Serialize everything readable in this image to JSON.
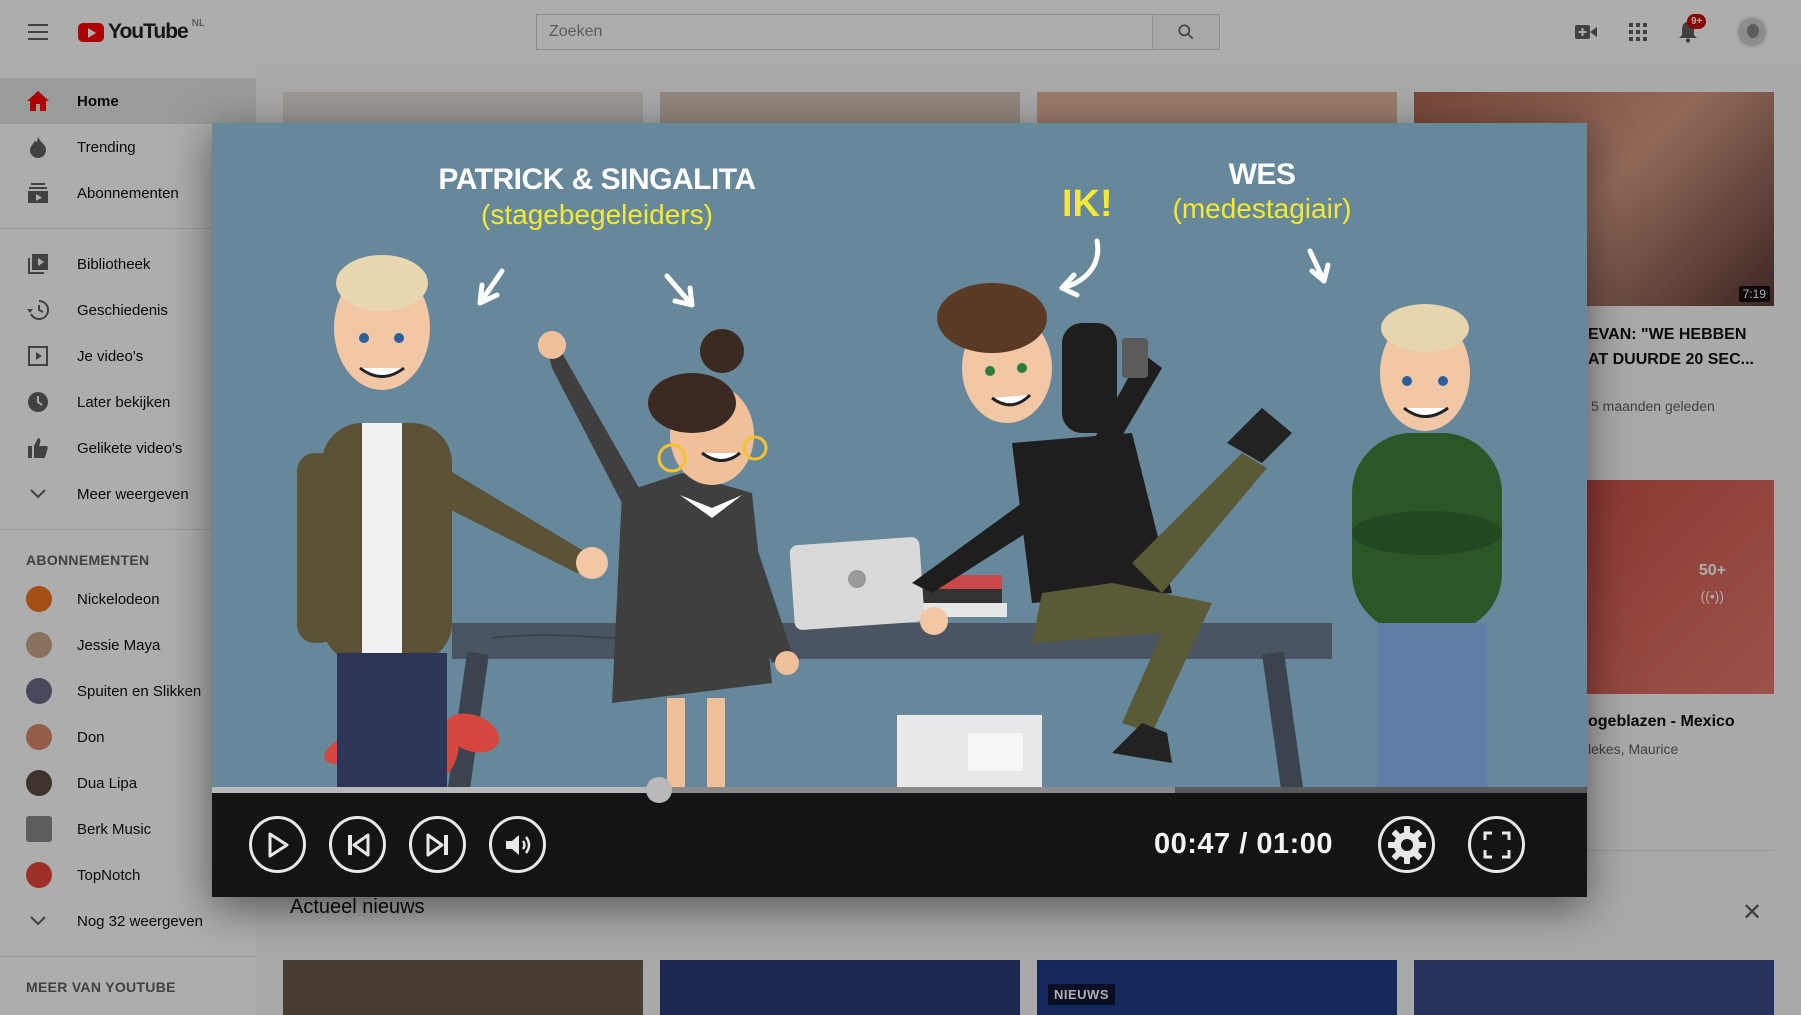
{
  "app": {
    "name": "YouTube",
    "region": "NL"
  },
  "header": {
    "search_placeholder": "Zoeken",
    "notification_count": "9+"
  },
  "sidebar": {
    "main": [
      {
        "label": "Home",
        "icon": "home-icon"
      },
      {
        "label": "Trending",
        "icon": "flame-icon"
      },
      {
        "label": "Abonnementen",
        "icon": "subscriptions-icon"
      }
    ],
    "library": [
      {
        "label": "Bibliotheek",
        "icon": "library-icon"
      },
      {
        "label": "Geschiedenis",
        "icon": "history-icon"
      },
      {
        "label": "Je video's",
        "icon": "play-square-icon"
      },
      {
        "label": "Later bekijken",
        "icon": "clock-icon"
      },
      {
        "label": "Gelikete video's",
        "icon": "thumb-up-icon"
      },
      {
        "label": "Meer weergeven",
        "icon": "chevron-down-icon"
      }
    ],
    "subscriptions_title": "ABONNEMENTEN",
    "subscriptions": [
      {
        "label": "Nickelodeon",
        "color": "#f47521"
      },
      {
        "label": "Jessie Maya",
        "color": "#c9a98b"
      },
      {
        "label": "Spuiten en Slikken",
        "color": "#6b6b8a"
      },
      {
        "label": "Don",
        "color": "#d98a6a"
      },
      {
        "label": "Dua Lipa",
        "color": "#5a4a42"
      },
      {
        "label": "Berk Music",
        "color": "#8a8a8a"
      },
      {
        "label": "TopNotch",
        "color": "#e8453c"
      },
      {
        "label": "Nog 32 weergeven",
        "color": ""
      }
    ],
    "more_title": "MEER VAN YOUTUBE"
  },
  "content": {
    "video_title_1": "EVAN: \"WE HEBBEN",
    "video_title_2": "AT DUURDE 20 SEC...",
    "video_meta": "5 maanden geleden",
    "video_duration": "7:19",
    "live_count": "50+",
    "video2_title": "ogeblazen - Mexico",
    "video2_meta": "lekes, Maurice",
    "news_section": "Actueel nieuws",
    "news_label": "NIEUWS"
  },
  "player": {
    "labels": {
      "group1_name": "PATRICK & SINGALITA",
      "group1_role": "(stagebegeleiders)",
      "me": "IK!",
      "group2_name": "WES",
      "group2_role": "(medestagiair)"
    },
    "current_time": "00:47",
    "duration": "01:00",
    "time_display": "00:47 / 01:00",
    "progress_fraction": 0.325,
    "buffered_fraction": 0.7
  },
  "colors": {
    "brand_red": "#ff0000",
    "label_yellow": "#f4ea34",
    "video_bg": "#67879a"
  }
}
